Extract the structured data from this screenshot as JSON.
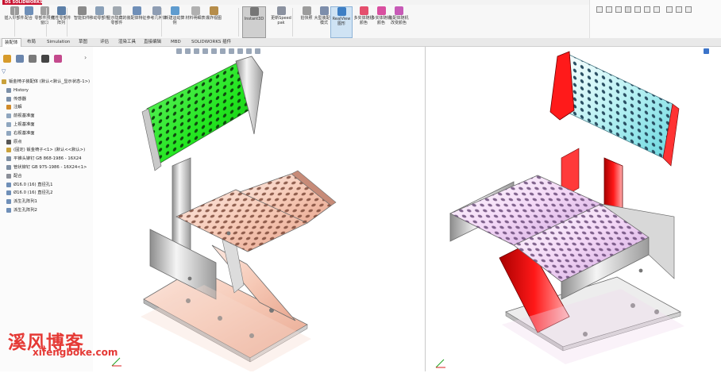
{
  "app": {
    "logo_text": "DS SOLIDWORKS"
  },
  "ribbon": {
    "buttons": [
      {
        "id": "insert-component",
        "label": "插入零部件"
      },
      {
        "id": "mate",
        "label": "配合"
      },
      {
        "id": "component-preview",
        "label": "零部件预览窗口"
      },
      {
        "id": "linear-pattern",
        "label": "线性零部件阵列"
      },
      {
        "id": "smart-fasteners",
        "label": "智能扣件"
      },
      {
        "id": "move-component",
        "label": "移动零部件"
      },
      {
        "id": "show-hidden",
        "label": "显示隐藏的零部件"
      },
      {
        "id": "assembly-features",
        "label": "装配体特征"
      },
      {
        "id": "reference-geometry",
        "label": "参考几何体"
      },
      {
        "id": "new-motion-study",
        "label": "新建运动算例"
      },
      {
        "id": "bill-of-materials",
        "label": "材料明细表"
      },
      {
        "id": "exploded-view",
        "label": "爆炸视图"
      },
      {
        "id": "instant3d",
        "label": "Instant3D"
      },
      {
        "id": "update-speedpak",
        "label": "更新Speedpak"
      },
      {
        "id": "take-snapshot",
        "label": "拍快照"
      },
      {
        "id": "large-assembly-mode",
        "label": "大型装配体模式"
      },
      {
        "id": "realview",
        "label": "RealView图形"
      },
      {
        "id": "random-color",
        "label": "多实体随机颜色"
      },
      {
        "id": "random-color-2",
        "label": "多实体随机颜色"
      },
      {
        "id": "random-color-change",
        "label": "装配体随机改变颜色"
      }
    ]
  },
  "tabs": [
    "装配体",
    "布局",
    "Simulation",
    "草图",
    "评估",
    "渲染工具",
    "直接编辑",
    "MBD",
    "SOLIDWORKS 插件"
  ],
  "feature_tree": {
    "items": [
      {
        "label": "钣金椅子装配体 (默认<默认_显示状态-1>)",
        "depth": 0,
        "color": "#c9a13b"
      },
      {
        "label": "History",
        "depth": 1,
        "color": "#7b8fa8"
      },
      {
        "label": "传感器",
        "depth": 1,
        "color": "#7b8fa8"
      },
      {
        "label": "注解",
        "depth": 1,
        "color": "#d08a2a"
      },
      {
        "label": "前视基准面",
        "depth": 1,
        "color": "#8fa6bf"
      },
      {
        "label": "上视基准面",
        "depth": 1,
        "color": "#8fa6bf"
      },
      {
        "label": "右视基准面",
        "depth": 1,
        "color": "#8fa6bf"
      },
      {
        "label": "原点",
        "depth": 1,
        "color": "#555555"
      },
      {
        "label": "(固定) 钣金椅子<1> (默认<<默认>)",
        "depth": 1,
        "color": "#c9a13b"
      },
      {
        "label": "平锥头铆钉 GB 868-1986 - 16X24",
        "depth": 1,
        "color": "#7d8ea3"
      },
      {
        "label": "管状铆钉 GB 975-1986 - 16X24<1>",
        "depth": 1,
        "color": "#7d8ea3"
      },
      {
        "label": "配合",
        "depth": 1,
        "color": "#8b8f98"
      },
      {
        "label": "Ø16.0 (16) 直径孔1",
        "depth": 1,
        "color": "#6f8fb8"
      },
      {
        "label": "Ø16.0 (16) 直径孔2",
        "depth": 1,
        "color": "#6f8fb8"
      },
      {
        "label": "派生孔阵列1",
        "depth": 1,
        "color": "#6f8fb8"
      },
      {
        "label": "派生孔阵列2",
        "depth": 1,
        "color": "#6f8fb8"
      }
    ]
  },
  "colors": {
    "seat_left_back": "#22e51f",
    "seat_left_body": "#f6c9b6",
    "seat_right_back": "#b8f1f3",
    "seat_right_red": "#ff1818",
    "seat_right_body": "#f3d7f6"
  },
  "watermark": {
    "chinese": "溪风博客",
    "url": "xifengboke.com"
  }
}
